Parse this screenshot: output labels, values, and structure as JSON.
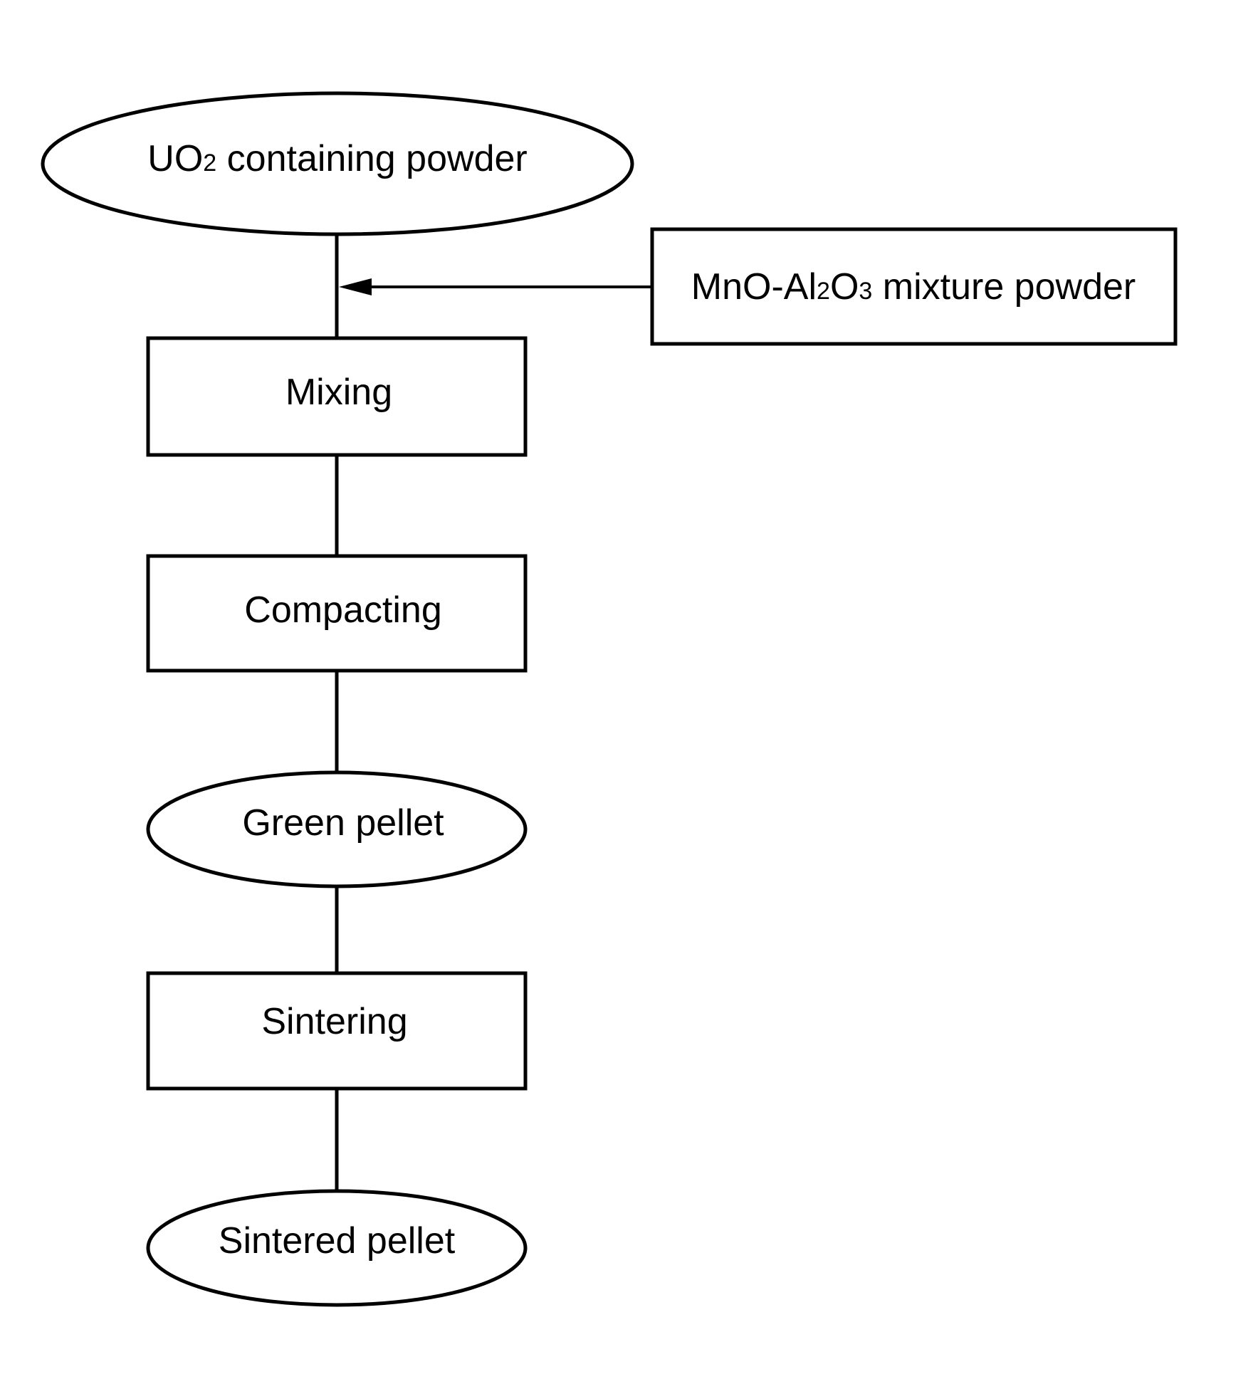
{
  "diagram": {
    "type": "process-flowchart",
    "colors": {
      "stroke": "#000000",
      "background": "#ffffff",
      "text": "#000000"
    },
    "nodes": [
      {
        "id": "uo2",
        "shape": "ellipse",
        "label": {
          "main": "UO",
          "sub": "2",
          "rest": " containing powder"
        }
      },
      {
        "id": "mno",
        "shape": "rectangle",
        "label": {
          "p1": "MnO-Al",
          "s1": "2",
          "p2": "O",
          "s2": "3",
          "p3": " mixture powder"
        }
      },
      {
        "id": "mixing",
        "shape": "rectangle",
        "label": "Mixing"
      },
      {
        "id": "compacting",
        "shape": "rectangle",
        "label": "Compacting"
      },
      {
        "id": "green",
        "shape": "ellipse",
        "label": "Green pellet"
      },
      {
        "id": "sintering",
        "shape": "rectangle",
        "label": "Sintering"
      },
      {
        "id": "sintered",
        "shape": "ellipse",
        "label": "Sintered pellet"
      }
    ],
    "edges": [
      {
        "from": "uo2",
        "to": "mixing",
        "arrow": false
      },
      {
        "from": "mno",
        "to": "uo2-mixing-connector",
        "arrow": true
      },
      {
        "from": "mixing",
        "to": "compacting",
        "arrow": false
      },
      {
        "from": "compacting",
        "to": "green",
        "arrow": false
      },
      {
        "from": "green",
        "to": "sintering",
        "arrow": false
      },
      {
        "from": "sintering",
        "to": "sintered",
        "arrow": false
      }
    ]
  }
}
